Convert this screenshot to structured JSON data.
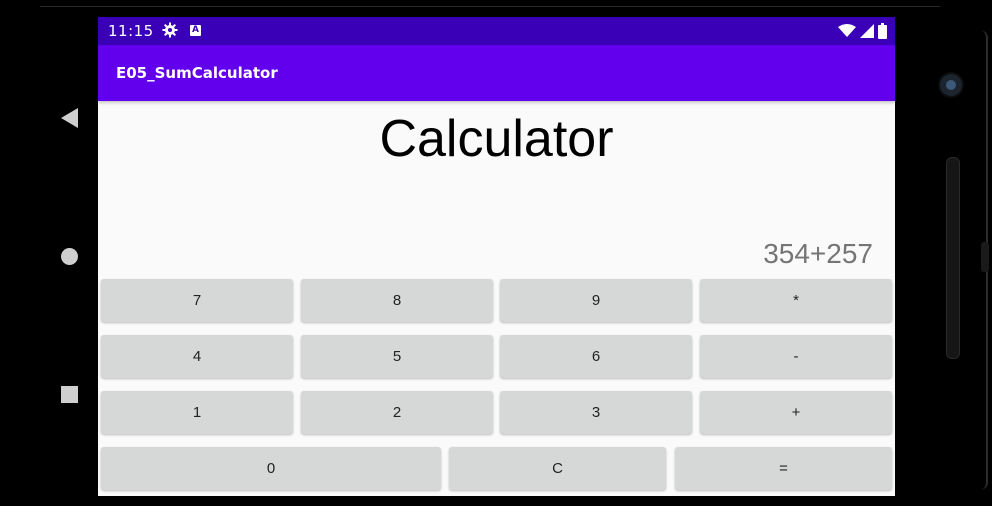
{
  "status_bar": {
    "time": "11:15",
    "a_badge": "A",
    "icons": [
      "gear-icon",
      "a-notification-icon",
      "wifi-icon",
      "signal-icon",
      "battery-icon"
    ]
  },
  "app": {
    "title": "E05_SumCalculator",
    "heading": "Calculator",
    "display": "354+257"
  },
  "keypad": {
    "rows": [
      [
        "7",
        "8",
        "9",
        "*"
      ],
      [
        "4",
        "5",
        "6",
        "-"
      ],
      [
        "1",
        "2",
        "3",
        "+"
      ],
      [
        "0",
        "C",
        "="
      ]
    ]
  },
  "nav": {
    "icons": [
      "back-icon",
      "home-icon",
      "recents-icon"
    ]
  },
  "colors": {
    "status_bar": "#3a00b8",
    "app_bar": "#6200ee",
    "key_background": "#d6d7d7",
    "screen_background": "#fafafa",
    "display_text": "#757575"
  }
}
